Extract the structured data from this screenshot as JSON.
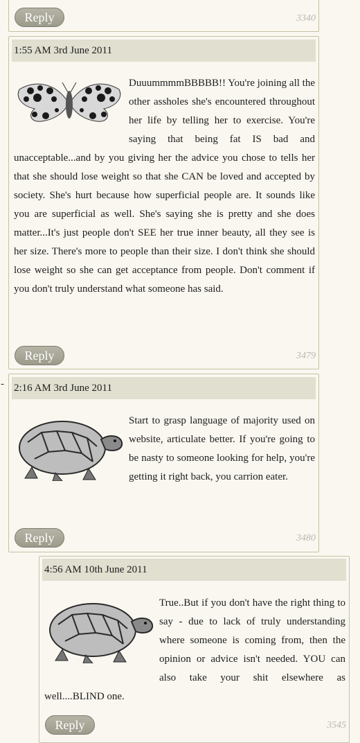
{
  "top_card": {
    "reply_label": "Reply",
    "id": "3340"
  },
  "posts": [
    {
      "timestamp": "1:55 AM 3rd June 2011",
      "avatar": "moth-icon",
      "text": "DuuummmmBBBBB!! You're joining all the other assholes she's encountered throughout her life by telling her to exercise. You're saying that being fat IS bad and unacceptable...and by you giving her the advice you chose to tells her that she should lose weight so that she CAN be loved and accepted by society. She's hurt because how superficial people are. It sounds like you are superficial as well. She's saying she is pretty and she does matter...It's just people don't SEE her true inner beauty, all they see is her size. There's more to people than their size. I don't think she should lose weight so she can get acceptance from people. Don't comment if you don't truly understand what someone has said.",
      "reply_label": "Reply",
      "id": "3479"
    },
    {
      "timestamp": "2:16 AM 3rd June 2011",
      "avatar": "tortoise-icon",
      "text": "Start to grasp language of majority used on website, articulate better. If you're going to be nasty to someone looking for help, you're getting it right back, you carrion eater.",
      "reply_label": "Reply",
      "id": "3480"
    },
    {
      "timestamp": "4:56 AM 10th June 2011",
      "avatar": "tortoise-icon",
      "text": "True..But if you don't have the right thing to say - due to lack of truly understanding where someone is coming from, then the opinion or advice isn't needed. YOU can also take your shit elsewhere as well....BLIND one.",
      "reply_label": "Reply",
      "id": "3545"
    }
  ],
  "thread_marker": "-"
}
